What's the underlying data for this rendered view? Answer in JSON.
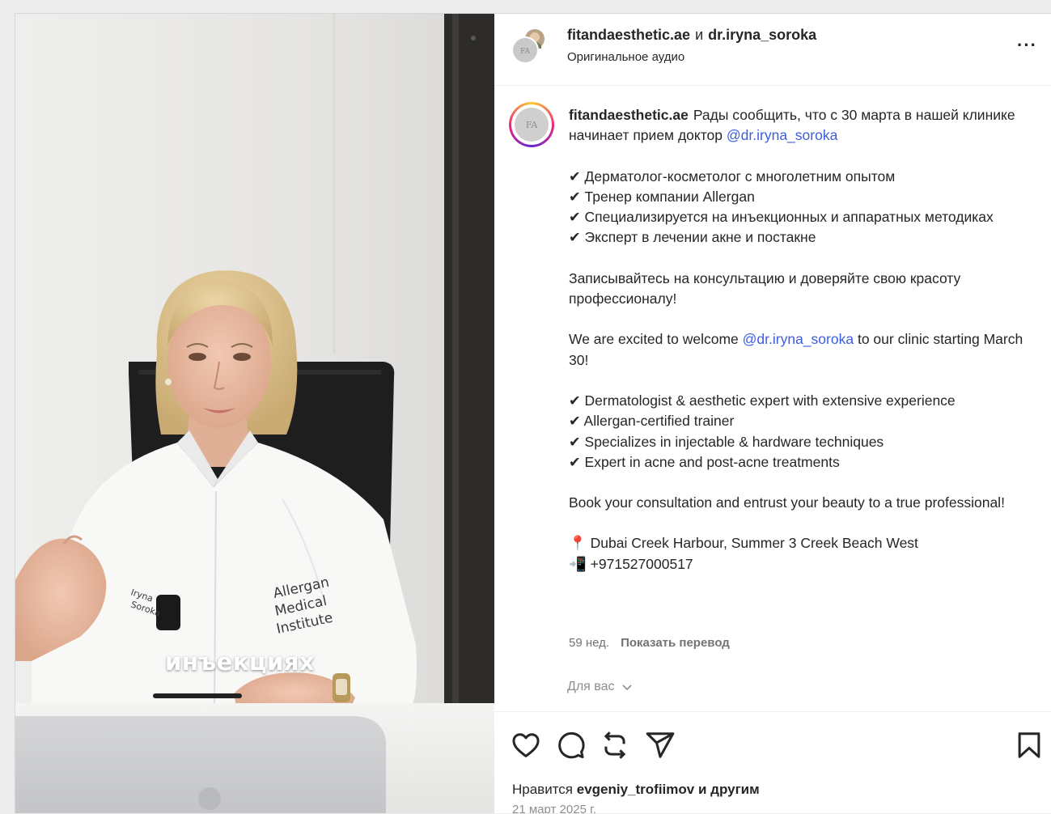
{
  "video": {
    "caption": "инъекциях",
    "coat_text": "Allergan Medical Institute",
    "badge_text": "Iryna Soroka"
  },
  "header": {
    "account": "fitandaesthetic.ae",
    "conjunction": "и",
    "collaborator": "dr.iryna_soroka",
    "audio": "Оригинальное аудио",
    "more": "···"
  },
  "post": {
    "author": "fitandaesthetic.ae",
    "avatar_initials": "FA",
    "intro": "Рады сообщить, что с 30 марта в нашей клинике начинает прием доктор",
    "mention": "@dr.iryna_soroka",
    "ru_points": [
      "✔ Дерматолог-косметолог с многолетним опытом",
      "✔ Тренер компании Allergan",
      "✔ Специализируется на инъекционных и аппаратных методиках",
      "✔ Эксперт в лечении акне и постакне"
    ],
    "ru_cta": "Записывайтесь на консультацию и доверяйте свою красоту профессионалу!",
    "en_intro_before": "We are excited to welcome",
    "en_mention": "@dr.iryna_soroka",
    "en_intro_after": "to our clinic starting March 30!",
    "en_points": [
      "✔ Dermatologist & aesthetic expert with extensive experience",
      "✔ Allergan-certified trainer",
      "✔ Specializes in injectable & hardware techniques",
      "✔ Expert in acne and post-acne treatments"
    ],
    "en_cta": "Book your consultation and entrust your beauty to a true professional!",
    "address": "📍 Dubai Creek Harbour, Summer 3 Creek Beach West",
    "phone": "📲 +971527000517",
    "age": "59 нед.",
    "translate": "Показать перевод",
    "for_you": "Для вас"
  },
  "footer": {
    "likes_prefix": "Нравится",
    "likes_user": "evgeniy_trofiimov",
    "likes_suffix": "и другим",
    "date": "21 март 2025 г."
  },
  "colors": {
    "mention": "#3b5de0",
    "text": "#262626",
    "muted": "#737373"
  },
  "icons": [
    "more-icon",
    "heart-icon",
    "comment-icon",
    "repost-icon",
    "share-icon",
    "bookmark-icon",
    "chevron-down-icon"
  ]
}
